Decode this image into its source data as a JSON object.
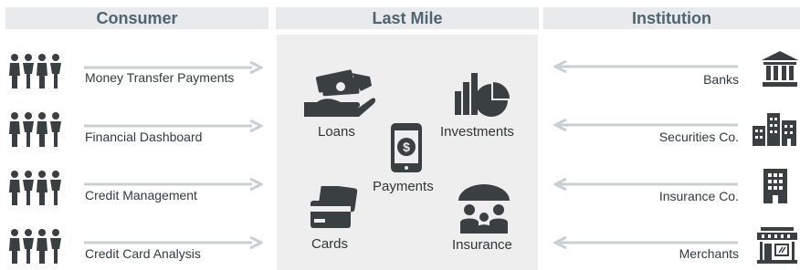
{
  "headers": {
    "consumer": "Consumer",
    "last_mile": "Last Mile",
    "institution": "Institution"
  },
  "consumer_items": [
    "Money Transfer Payments",
    "Financial Dashboard",
    "Credit Management",
    "Credit Card Analysis"
  ],
  "last_mile_items": {
    "loans": "Loans",
    "investments": "Investments",
    "payments": "Payments",
    "cards": "Cards",
    "insurance": "Insurance"
  },
  "institution_items": [
    "Banks",
    "Securities Co.",
    "Insurance Co.",
    "Merchants"
  ],
  "colors": {
    "header_bg": "#e8eaeb",
    "header_text": "#4e6470",
    "panel_bg": "#eeeeee",
    "icon": "#3a3f42",
    "arrow": "#c8d0d4"
  },
  "icons": {
    "consumer": "people-group-icon",
    "loans": "hand-money-icon",
    "investments": "bar-pie-chart-icon",
    "payments": "mobile-payment-icon",
    "cards": "credit-cards-icon",
    "insurance": "umbrella-family-icon",
    "banks": "bank-building-icon",
    "securities": "city-buildings-icon",
    "insurance_co": "office-building-icon",
    "merchants": "storefront-icon"
  }
}
